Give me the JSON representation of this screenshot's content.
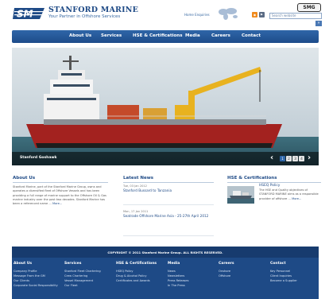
{
  "header": {
    "brand": "STANFORD MARINE",
    "tagline": "Your Partner in Offshore Services",
    "links": "Home   Enquiries",
    "sg_logo": "SMG",
    "search_placeholder": "Search website",
    "search_button": "»"
  },
  "nav": {
    "items": [
      "About Us",
      "Services",
      "HSE & Certifications",
      "Media",
      "Careers",
      "Contact"
    ]
  },
  "hero": {
    "caption": "Stanford Goshawk",
    "prev": "‹",
    "next": "›",
    "pages": [
      "1",
      "2",
      "3",
      "4"
    ]
  },
  "about": {
    "title": "About Us",
    "text": "Stanford Marine, part of the Stanford Marine Group, owns and operates a diversified fleet of Offshore Vessels and has been providing a full range of marine support to the Offshore Oil & Gas marine industry over the past two decades. Stanford Marine has been a referenced name ...",
    "more": "More..."
  },
  "news": {
    "title": "Latest News",
    "items": [
      {
        "date": "Tue, 03 Jan 2012",
        "title": "Stanford Bussard to Tanzania"
      },
      {
        "date": "Mon, 17 Jan 2011",
        "title": "Seatrade Offshore Marine Asia - 25-27th April 2012"
      }
    ]
  },
  "hse": {
    "title": "HSE & Certifications",
    "item_title": "HSEQ Policy",
    "text": "The HSE and Quality objectives of STANFORD MARINE aims as a responsible provider of offshore ...",
    "more": "More..."
  },
  "footer": {
    "copyright": "COPYRIGHT © 2011  Stanford Marine Group. ALL RIGHTS RESERVED.",
    "columns": [
      {
        "title": "About Us",
        "links": [
          "Company Profile",
          "Message From the GM",
          "Our Clients",
          "Corporate Social Responsibility"
        ]
      },
      {
        "title": "Services",
        "links": [
          "Stanford Fleet Chartering",
          "Crew Chartering",
          "Vessel Management",
          "Our Fleet"
        ]
      },
      {
        "title": "HSE & Certifications",
        "links": [
          "HSEQ Policy",
          "Drug & Alcohol Policy",
          "Certificates and Awards"
        ]
      },
      {
        "title": "Media",
        "links": [
          "News",
          "Newsletters",
          "Press Releases",
          "In The Press"
        ]
      },
      {
        "title": "Careers",
        "links": [
          "Onshore",
          "Offshore"
        ]
      },
      {
        "title": "Contact",
        "links": [
          "Key Personnel",
          "Client Inquiries",
          "Become a Supplier"
        ]
      }
    ]
  },
  "colors": {
    "primary": "#1e4a86",
    "nav": "#2f66a8",
    "accent": "#f08a1c"
  }
}
